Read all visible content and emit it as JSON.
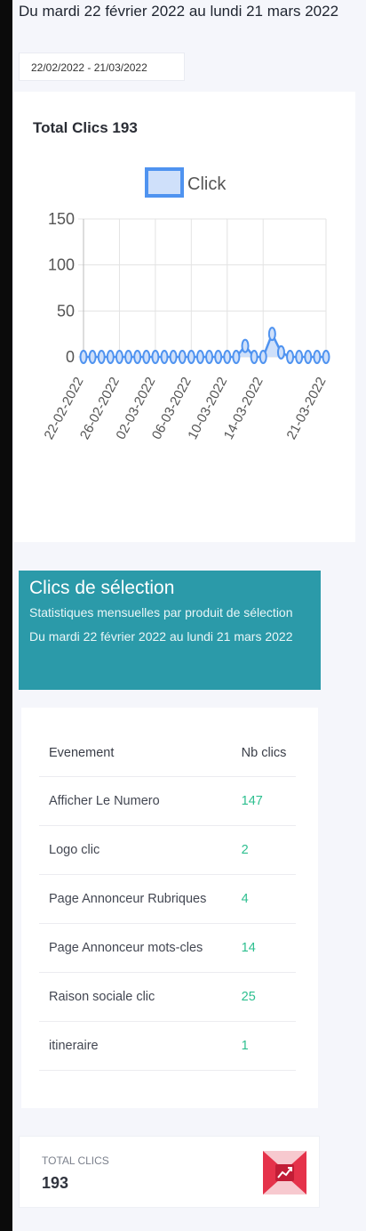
{
  "header": {
    "period": "Du mardi 22 février 2022 au lundi 21 mars 2022",
    "date_range_value": "22/02/2022 - 21/03/2022"
  },
  "chart_card": {
    "title": "Total Clics 193"
  },
  "chart_data": {
    "type": "area",
    "series": [
      {
        "name": "Click",
        "color": "#4f93f0",
        "fill": "#cfe0fa",
        "x": [
          "22-02-2022",
          "23-02-2022",
          "24-02-2022",
          "25-02-2022",
          "26-02-2022",
          "27-02-2022",
          "28-02-2022",
          "01-03-2022",
          "02-03-2022",
          "03-03-2022",
          "04-03-2022",
          "05-03-2022",
          "06-03-2022",
          "07-03-2022",
          "08-03-2022",
          "09-03-2022",
          "10-03-2022",
          "11-03-2022",
          "12-03-2022",
          "13-03-2022",
          "14-03-2022",
          "15-03-2022",
          "16-03-2022",
          "17-03-2022",
          "18-03-2022",
          "19-03-2022",
          "20-03-2022",
          "21-03-2022"
        ],
        "values": [
          0,
          0,
          0,
          0,
          0,
          0,
          0,
          0,
          0,
          0,
          0,
          0,
          0,
          0,
          0,
          0,
          0,
          0,
          12,
          0,
          0,
          25,
          5,
          0,
          0,
          0,
          0,
          0
        ]
      }
    ],
    "x_tick_labels": [
      "22-02-2022",
      "26-02-2022",
      "02-03-2022",
      "06-03-2022",
      "10-03-2022",
      "14-03-2022",
      "21-03-2022"
    ],
    "y_ticks": [
      0,
      50,
      100,
      150
    ],
    "ylim": [
      0,
      150
    ],
    "legend_position": "top-center",
    "grid": true
  },
  "selection": {
    "title": "Clics de sélection",
    "subtitle": "Statistiques mensuelles par produit de sélection Du mardi 22 février 2022 au lundi 21 mars 2022"
  },
  "table": {
    "headers": [
      "Evenement",
      "Nb clics"
    ],
    "rows": [
      {
        "event": "Afficher Le Numero",
        "clicks": "147"
      },
      {
        "event": "Logo clic",
        "clicks": "2"
      },
      {
        "event": "Page Annonceur Rubriques",
        "clicks": "4"
      },
      {
        "event": "Page Annonceur mots-cles",
        "clicks": "14"
      },
      {
        "event": "Raison sociale clic",
        "clicks": "25"
      },
      {
        "event": "itineraire",
        "clicks": "1"
      }
    ]
  },
  "total": {
    "label": "TOTAL CLICS",
    "value": "193",
    "icon": "chart-growth-icon",
    "icon_color": "#e5324a"
  }
}
